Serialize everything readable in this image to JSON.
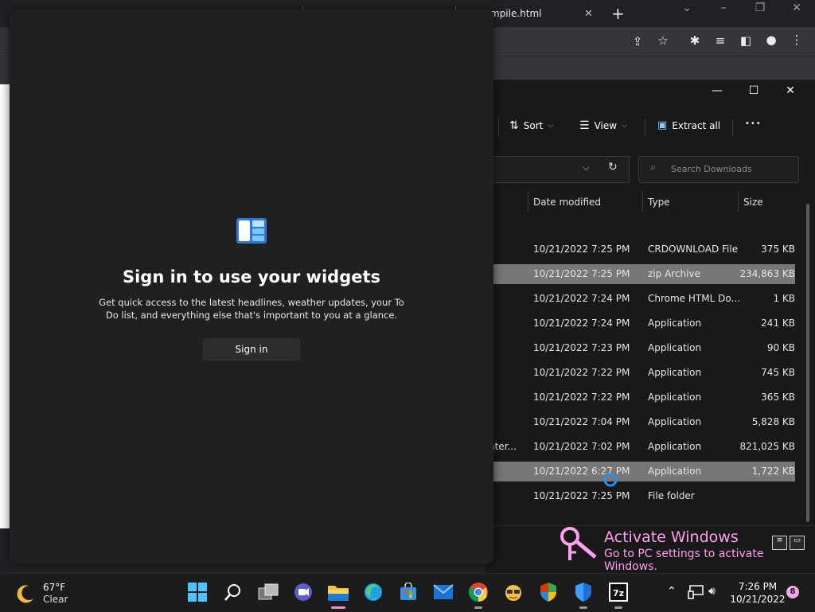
{
  "browser": {
    "tab_title": "mpile.html",
    "tab_close": "✕",
    "new_tab": "+",
    "controls": {
      "chevron": "⌄",
      "minimize": "–",
      "restore": "❐",
      "close": "✕"
    }
  },
  "widgets": {
    "title": "Sign in to use your widgets",
    "description": "Get quick access to the latest headlines, weather updates, your To Do list, and everything else that's important to you at a glance.",
    "signin_label": "Sign in"
  },
  "explorer": {
    "controls": {
      "minimize": "—",
      "maximize": "☐",
      "close": "✕"
    },
    "commands": {
      "sort": "Sort",
      "view": "View",
      "extract": "Extract all",
      "more": "•••"
    },
    "search_placeholder": "Search Downloads",
    "columns": {
      "date": "Date modified",
      "type": "Type",
      "size": "Size"
    },
    "rows": [
      {
        "name": "",
        "date": "10/21/2022 7:25 PM",
        "type": "CRDOWNLOAD File",
        "size": "375 KB",
        "selected": false
      },
      {
        "name": "",
        "date": "10/21/2022 7:25 PM",
        "type": "zip Archive",
        "size": "234,863 KB",
        "selected": true
      },
      {
        "name": "",
        "date": "10/21/2022 7:24 PM",
        "type": "Chrome HTML Do...",
        "size": "1 KB",
        "selected": false
      },
      {
        "name": "",
        "date": "10/21/2022 7:24 PM",
        "type": "Application",
        "size": "241 KB",
        "selected": false
      },
      {
        "name": "",
        "date": "10/21/2022 7:23 PM",
        "type": "Application",
        "size": "90 KB",
        "selected": false
      },
      {
        "name": "",
        "date": "10/21/2022 7:22 PM",
        "type": "Application",
        "size": "745 KB",
        "selected": false
      },
      {
        "name": "",
        "date": "10/21/2022 7:22 PM",
        "type": "Application",
        "size": "365 KB",
        "selected": false
      },
      {
        "name": "",
        "date": "10/21/2022 7:04 PM",
        "type": "Application",
        "size": "5,828 KB",
        "selected": false
      },
      {
        "name": "nter...",
        "date": "10/21/2022 7:02 PM",
        "type": "Application",
        "size": "821,025 KB",
        "selected": false
      },
      {
        "name": "",
        "date": "10/21/2022 6:27 PM",
        "type": "Application",
        "size": "1,722 KB",
        "selected": true
      },
      {
        "name": "",
        "date": "10/21/2022 7:25 PM",
        "type": "File folder",
        "size": "",
        "selected": false
      }
    ]
  },
  "activation": {
    "line1": "Activate Windows",
    "line2": "Go to PC settings to activate Windows."
  },
  "taskbar": {
    "weather_temp": "67°F",
    "weather_cond": "Clear",
    "time": "7:26 PM",
    "date": "10/21/2022",
    "notification_count": "8",
    "apps": [
      "start",
      "search",
      "task-view",
      "teams-chat",
      "file-explorer",
      "edge",
      "store",
      "mail",
      "chrome",
      "app-glasses",
      "security-shield",
      "defender",
      "7zip"
    ],
    "active_app": "file-explorer"
  },
  "colors": {
    "accent_pink": "#ff89d9",
    "selection_gray": "#777777",
    "widget_bg": "#202020"
  }
}
